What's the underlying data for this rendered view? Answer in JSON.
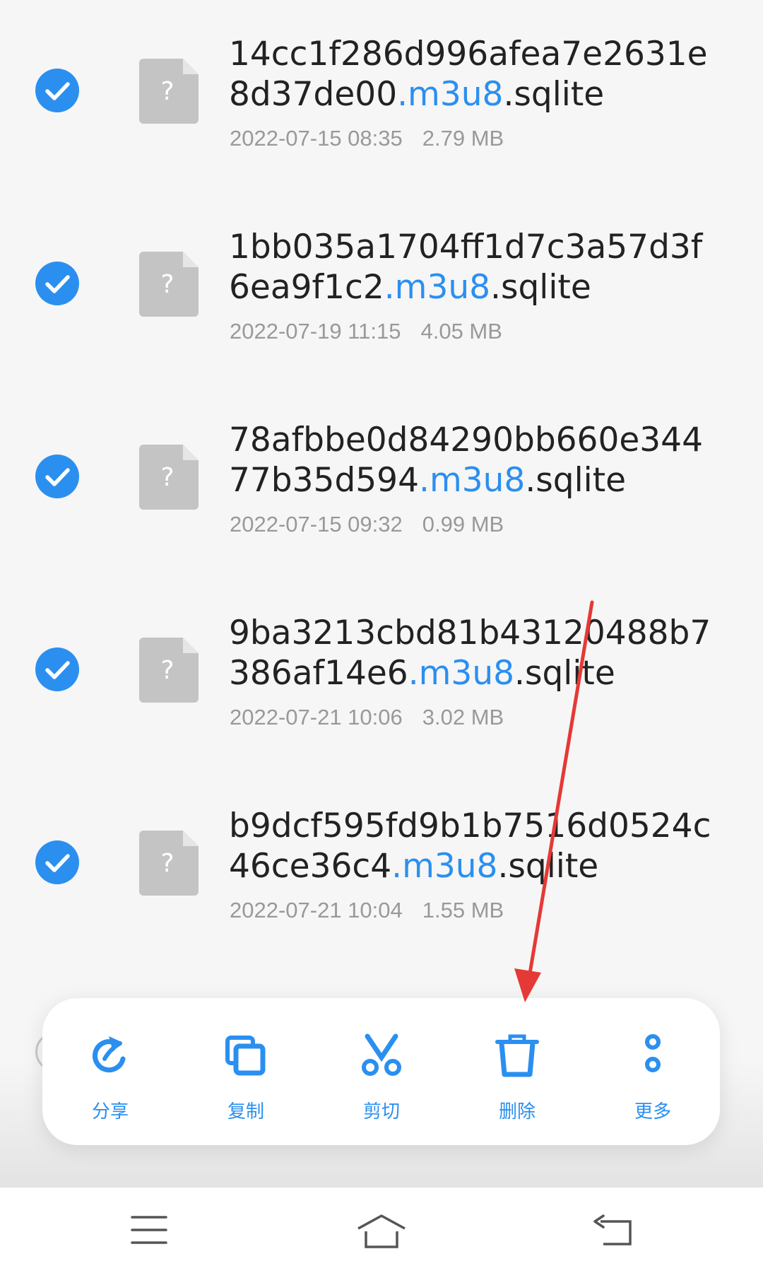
{
  "files": [
    {
      "name_line1": "14cc1f286d996afea7e2631e",
      "name_line2_base": "8d37de00",
      "ext_mid": ".m3u8",
      "ext_end": ".sqlite",
      "date": "2022-07-15 08:35",
      "size": "2.79 MB",
      "selected": true
    },
    {
      "name_line1": "1bb035a1704ff1d7c3a57d3f",
      "name_line2_base": "6ea9f1c2",
      "ext_mid": ".m3u8",
      "ext_end": ".sqlite",
      "date": "2022-07-19 11:15",
      "size": "4.05 MB",
      "selected": true
    },
    {
      "name_line1": "78afbbe0d84290bb660e344",
      "name_line2_base": "77b35d594",
      "ext_mid": ".m3u8",
      "ext_end": ".sqlite",
      "date": "2022-07-15 09:32",
      "size": "0.99 MB",
      "selected": true
    },
    {
      "name_line1": "9ba3213cbd81b43120488b7",
      "name_line2_base": "386af14e6",
      "ext_mid": ".m3u8",
      "ext_end": ".sqlite",
      "date": "2022-07-21 10:06",
      "size": "3.02 MB",
      "selected": true
    },
    {
      "name_line1": "b9dcf595fd9b1b7516d0524c",
      "name_line2_base": "46ce36c4",
      "ext_mid": ".m3u8",
      "ext_end": ".sqlite",
      "date": "2022-07-21 10:04",
      "size": "1.55 MB",
      "selected": true
    }
  ],
  "file_icon_glyph": "?",
  "actions": [
    {
      "label": "分享",
      "icon": "share-icon"
    },
    {
      "label": "复制",
      "icon": "copy-icon"
    },
    {
      "label": "剪切",
      "icon": "cut-icon"
    },
    {
      "label": "删除",
      "icon": "delete-icon"
    },
    {
      "label": "更多",
      "icon": "more-icon"
    }
  ],
  "nav": [
    {
      "icon": "menu-icon"
    },
    {
      "icon": "home-icon"
    },
    {
      "icon": "back-icon"
    }
  ],
  "colors": {
    "accent": "#2b8ff0",
    "annotation_arrow": "#e53935",
    "file_icon": "#c4c4c4"
  }
}
